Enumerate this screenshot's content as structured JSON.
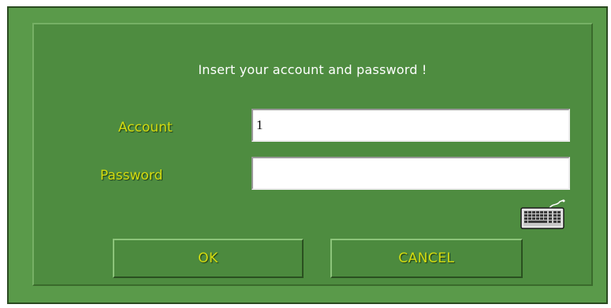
{
  "dialog": {
    "title": "Insert your account and password !",
    "account_label": "Account",
    "account_value": "1",
    "password_label": "Password",
    "password_value": "",
    "keyboard_icon": "virtual-keyboard-icon",
    "ok_label": "OK",
    "cancel_label": "CANCEL"
  },
  "colors": {
    "frame_bg": "#5a9a4a",
    "panel_bg": "#4e8c40",
    "label_color": "#d4dc10",
    "title_color": "#ffffff"
  }
}
